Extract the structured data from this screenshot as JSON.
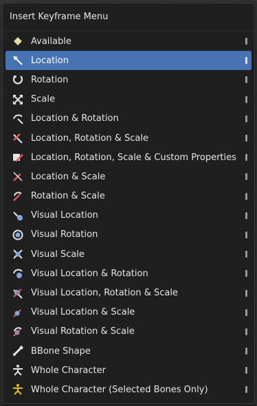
{
  "menu": {
    "title": "Insert Keyframe Menu",
    "items": [
      {
        "label": "Available",
        "icon": "diamond-icon",
        "color": "#e8d9a0"
      },
      {
        "label": "Location",
        "icon": "location-icon",
        "color": "#ffffff",
        "active": true
      },
      {
        "label": "Rotation",
        "icon": "rotation-icon",
        "color": "#e6e6e6"
      },
      {
        "label": "Scale",
        "icon": "scale-icon",
        "color": "#e6e6e6"
      },
      {
        "label": "Location & Rotation",
        "icon": "location-rotation-icon",
        "color": "#e6e6e6"
      },
      {
        "label": "Location, Rotation & Scale",
        "icon": "location-rotation-scale-icon",
        "color": "#e05a5a"
      },
      {
        "label": "Location, Rotation, Scale & Custom Properties",
        "icon": "custom-properties-icon",
        "color": "#e05a5a"
      },
      {
        "label": "Location & Scale",
        "icon": "location-scale-icon",
        "color": "#e05a5a"
      },
      {
        "label": "Rotation & Scale",
        "icon": "rotation-scale-icon",
        "color": "#e05a5a"
      },
      {
        "label": "Visual Location",
        "icon": "visual-location-icon",
        "color": "#7fa8e0"
      },
      {
        "label": "Visual Rotation",
        "icon": "visual-rotation-icon",
        "color": "#7fa8e0"
      },
      {
        "label": "Visual Scale",
        "icon": "visual-scale-icon",
        "color": "#7fa8e0"
      },
      {
        "label": "Visual Location & Rotation",
        "icon": "visual-location-rotation-icon",
        "color": "#7fa8e0"
      },
      {
        "label": "Visual Location, Rotation & Scale",
        "icon": "visual-location-rotation-scale-icon",
        "color": "#e05a5a"
      },
      {
        "label": "Visual Location & Scale",
        "icon": "visual-location-scale-icon",
        "color": "#e05a5a"
      },
      {
        "label": "Visual Rotation & Scale",
        "icon": "visual-rotation-scale-icon",
        "color": "#e05a5a"
      },
      {
        "label": "BBone Shape",
        "icon": "bbone-icon",
        "color": "#e6e6e6"
      },
      {
        "label": "Whole Character",
        "icon": "armature-icon",
        "color": "#e6e6e6"
      },
      {
        "label": "Whole Character (Selected Bones Only)",
        "icon": "armature-selected-icon",
        "color": "#f0c020"
      }
    ]
  },
  "colors": {
    "menu_bg": "#1f1f1f",
    "active_bg": "#4772b3",
    "text": "#e6e6e6"
  }
}
